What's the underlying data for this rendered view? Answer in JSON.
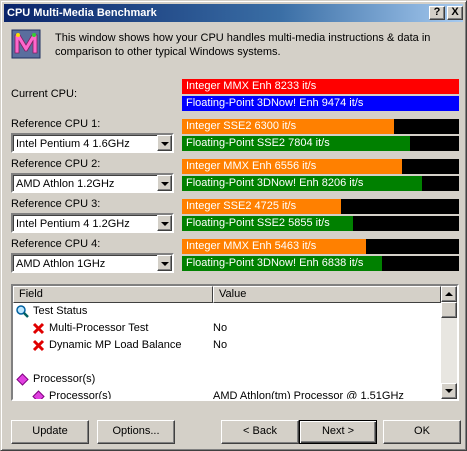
{
  "window": {
    "title": "CPU Multi-Media Benchmark",
    "help_button": "?",
    "close_button": "X"
  },
  "header": {
    "icon": "multimedia-m-icon",
    "text": "This window shows how your CPU handles multi-media instructions & data in comparison to other typical Windows systems."
  },
  "rows": [
    {
      "label": "Current CPU:",
      "combo": null,
      "bars": [
        {
          "text": "Integer MMX Enh 8233 it/s",
          "color": "#ff0000",
          "fraction": 1.0
        },
        {
          "text": "Floating-Point 3DNow! Enh 9474 it/s",
          "color": "#0000ff",
          "fraction": 1.0
        }
      ]
    },
    {
      "label": "Reference CPU 1:",
      "combo": "Intel Pentium 4 1.6GHz",
      "bars": [
        {
          "text": "Integer SSE2 6300 it/s",
          "color": "#ff8000",
          "fraction": 0.765
        },
        {
          "text": "Floating-Point SSE2 7804 it/s",
          "color": "#008000",
          "fraction": 0.824
        }
      ]
    },
    {
      "label": "Reference CPU 2:",
      "combo": "AMD Athlon 1.2GHz",
      "bars": [
        {
          "text": "Integer MMX Enh 6556 it/s",
          "color": "#ff8000",
          "fraction": 0.796
        },
        {
          "text": "Floating-Point 3DNow! Enh 8206 it/s",
          "color": "#008000",
          "fraction": 0.866
        }
      ]
    },
    {
      "label": "Reference CPU 3:",
      "combo": "Intel Pentium 4 1.2GHz",
      "bars": [
        {
          "text": "Integer SSE2 4725 it/s",
          "color": "#ff8000",
          "fraction": 0.574
        },
        {
          "text": "Floating-Point SSE2 5855 it/s",
          "color": "#008000",
          "fraction": 0.618
        }
      ]
    },
    {
      "label": "Reference CPU 4:",
      "combo": "AMD Athlon 1GHz",
      "bars": [
        {
          "text": "Integer MMX Enh 5463 it/s",
          "color": "#ff8000",
          "fraction": 0.664
        },
        {
          "text": "Floating-Point 3DNow! Enh 6838 it/s",
          "color": "#008000",
          "fraction": 0.722
        }
      ]
    }
  ],
  "list": {
    "columns": [
      "Field",
      "Value"
    ],
    "rows": [
      {
        "level": 0,
        "icon": "magnifier-icon",
        "field": "Test Status",
        "value": ""
      },
      {
        "level": 1,
        "icon": "red-x-icon",
        "field": "Multi-Processor Test",
        "value": "No"
      },
      {
        "level": 1,
        "icon": "red-x-icon",
        "field": "Dynamic MP Load Balance",
        "value": "No"
      },
      {
        "level": 0,
        "icon": "",
        "field": "",
        "value": ""
      },
      {
        "level": 0,
        "icon": "pink-diamond-icon",
        "field": "Processor(s)",
        "value": ""
      },
      {
        "level": 1,
        "icon": "pink-diamond-icon",
        "field": "Processor(s)",
        "value": "AMD Athlon(tm) Processor @ 1.51GHz"
      }
    ]
  },
  "buttons": {
    "update": "Update",
    "options": "Options...",
    "back": "< Back",
    "next": "Next >",
    "ok": "OK"
  }
}
